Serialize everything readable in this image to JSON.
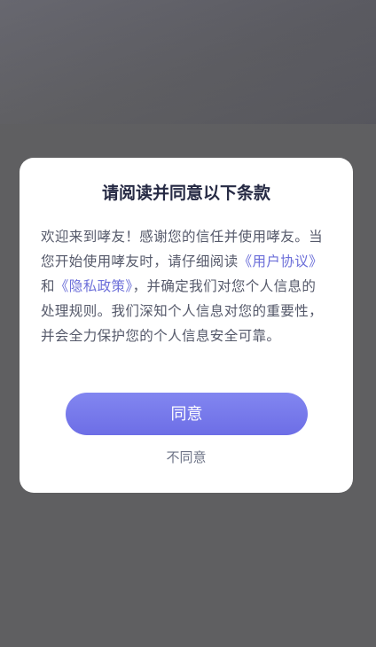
{
  "dialog": {
    "title": "请阅读并同意以下条款",
    "text_before": "欢迎来到哮友！感谢您的信任并使用哮友。当您开始使用哮友时，请仔细阅读",
    "user_agreement_link": "《用户协议》",
    "text_and": "和",
    "privacy_policy_link": "《隐私政策》",
    "text_after": "，并确定我们对您个人信息的处理规则。我们深知个人信息对您的重要性，并会全力保护您的个人信息安全可靠。",
    "agree_label": "同意",
    "disagree_label": "不同意"
  },
  "colors": {
    "overlay": "#5f5f61",
    "dialog_background": "#ffffff",
    "title": "#262a44",
    "body_text": "#55596a",
    "link": "#6c6fd9",
    "button_gradient_top": "#8286f0",
    "button_gradient_bottom": "#6d6ee6",
    "disagree_text": "#6e7487"
  }
}
